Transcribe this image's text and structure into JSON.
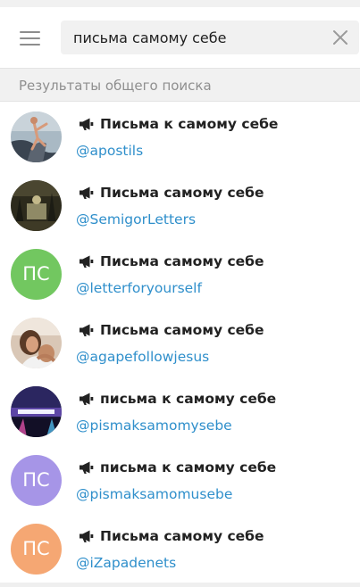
{
  "header": {
    "search_value": "письма самому себе",
    "menu_icon": "hamburger-menu-icon",
    "clear_icon": "close-icon"
  },
  "section": {
    "label": "Результаты общего поиска"
  },
  "results": [
    {
      "title": "Письма к самому себе",
      "username": "@apostils",
      "avatar_kind": "photo",
      "avatar_subject": "person-climbing-rock"
    },
    {
      "title": "Письма самому себе",
      "username": "@SemigorLetters",
      "avatar_kind": "photo",
      "avatar_subject": "dark-forest-scene"
    },
    {
      "title": "Письма самому себе",
      "username": "@letterforyourself",
      "avatar_kind": "initials",
      "initials": "ПС",
      "color": "#72c760"
    },
    {
      "title": "Письма самому себе",
      "username": "@agapefollowjesus",
      "avatar_kind": "photo",
      "avatar_subject": "embrace"
    },
    {
      "title": "письма к самому себе",
      "username": "@pismaksamomysebe",
      "avatar_kind": "photo",
      "avatar_subject": "neon-night-sign"
    },
    {
      "title": "письма к самому себе",
      "username": "@pismaksamomusebe",
      "avatar_kind": "initials",
      "initials": "ПС",
      "color": "#a695e7"
    },
    {
      "title": "Письма самому себе",
      "username": "@iZapadenets",
      "avatar_kind": "initials",
      "initials": "ПС",
      "color": "#f5a773"
    }
  ],
  "colors": {
    "accent_link": "#2f8fcb",
    "section_bg": "#f1f1f1",
    "channel_icon": "#222222"
  }
}
